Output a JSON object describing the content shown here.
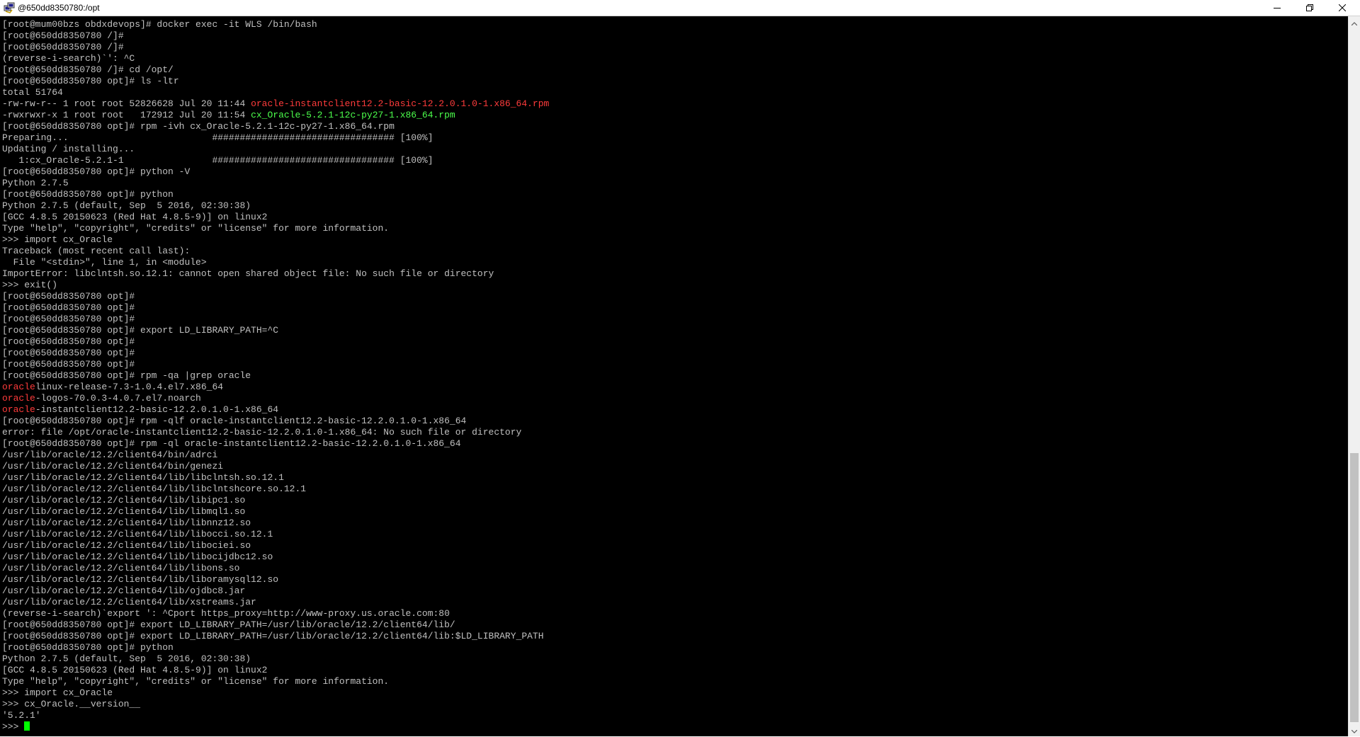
{
  "window": {
    "title": "@650dd8350780:/opt",
    "icon": "putty-icon",
    "controls": [
      "minimize-icon",
      "maximize-icon",
      "close-icon"
    ]
  },
  "colors": {
    "background": "#000000",
    "text": "#c0c0c0",
    "highlight_red": "#ff3b3b",
    "highlight_green": "#4cff4c",
    "cursor": "#00ff00"
  },
  "terminal": {
    "lines": [
      [
        {
          "t": "[root@mum00bzs obdxdevops]# docker exec -it WLS /bin/bash"
        }
      ],
      [
        {
          "t": "[root@650dd8350780 /]#"
        }
      ],
      [
        {
          "t": "[root@650dd8350780 /]#"
        }
      ],
      [
        {
          "t": "(reverse-i-search)`': ^C"
        }
      ],
      [
        {
          "t": "[root@650dd8350780 /]# cd /opt/"
        }
      ],
      [
        {
          "t": "[root@650dd8350780 opt]# ls -ltr"
        }
      ],
      [
        {
          "t": "total 51764"
        }
      ],
      [
        {
          "t": "-rw-rw-r-- 1 root root 52826628 Jul 20 11:44 "
        },
        {
          "t": "oracle-instantclient12.2-basic-12.2.0.1.0-1.x86_64.rpm",
          "c": "red"
        }
      ],
      [
        {
          "t": "-rwxrwxr-x 1 root root   172912 Jul 20 11:54 "
        },
        {
          "t": "cx_Oracle-5.2.1-12c-py27-1.x86_64.rpm",
          "c": "green"
        }
      ],
      [
        {
          "t": "[root@650dd8350780 opt]# rpm -ivh cx_Oracle-5.2.1-12c-py27-1.x86_64.rpm"
        }
      ],
      [
        {
          "t": "Preparing...                          ################################# [100%]"
        }
      ],
      [
        {
          "t": "Updating / installing..."
        }
      ],
      [
        {
          "t": "   1:cx_Oracle-5.2.1-1                ################################# [100%]"
        }
      ],
      [
        {
          "t": "[root@650dd8350780 opt]# python -V"
        }
      ],
      [
        {
          "t": "Python 2.7.5"
        }
      ],
      [
        {
          "t": "[root@650dd8350780 opt]# python"
        }
      ],
      [
        {
          "t": "Python 2.7.5 (default, Sep  5 2016, 02:30:38)"
        }
      ],
      [
        {
          "t": "[GCC 4.8.5 20150623 (Red Hat 4.8.5-9)] on linux2"
        }
      ],
      [
        {
          "t": "Type \"help\", \"copyright\", \"credits\" or \"license\" for more information."
        }
      ],
      [
        {
          "t": ">>> import cx_Oracle"
        }
      ],
      [
        {
          "t": "Traceback (most recent call last):"
        }
      ],
      [
        {
          "t": "  File \"<stdin>\", line 1, in <module>"
        }
      ],
      [
        {
          "t": "ImportError: libclntsh.so.12.1: cannot open shared object file: No such file or directory"
        }
      ],
      [
        {
          "t": ">>> exit()"
        }
      ],
      [
        {
          "t": "[root@650dd8350780 opt]#"
        }
      ],
      [
        {
          "t": "[root@650dd8350780 opt]#"
        }
      ],
      [
        {
          "t": "[root@650dd8350780 opt]#"
        }
      ],
      [
        {
          "t": "[root@650dd8350780 opt]# export LD_LIBRARY_PATH=^C"
        }
      ],
      [
        {
          "t": "[root@650dd8350780 opt]#"
        }
      ],
      [
        {
          "t": "[root@650dd8350780 opt]#"
        }
      ],
      [
        {
          "t": "[root@650dd8350780 opt]#"
        }
      ],
      [
        {
          "t": "[root@650dd8350780 opt]# rpm -qa |grep oracle"
        }
      ],
      [
        {
          "t": "oracle",
          "c": "red"
        },
        {
          "t": "linux-release-7.3-1.0.4.el7.x86_64"
        }
      ],
      [
        {
          "t": "oracle",
          "c": "red"
        },
        {
          "t": "-logos-70.0.3-4.0.7.el7.noarch"
        }
      ],
      [
        {
          "t": "oracle",
          "c": "red"
        },
        {
          "t": "-instantclient12.2-basic-12.2.0.1.0-1.x86_64"
        }
      ],
      [
        {
          "t": "[root@650dd8350780 opt]# rpm -qlf oracle-instantclient12.2-basic-12.2.0.1.0-1.x86_64"
        }
      ],
      [
        {
          "t": "error: file /opt/oracle-instantclient12.2-basic-12.2.0.1.0-1.x86_64: No such file or directory"
        }
      ],
      [
        {
          "t": "[root@650dd8350780 opt]# rpm -ql oracle-instantclient12.2-basic-12.2.0.1.0-1.x86_64"
        }
      ],
      [
        {
          "t": "/usr/lib/oracle/12.2/client64/bin/adrci"
        }
      ],
      [
        {
          "t": "/usr/lib/oracle/12.2/client64/bin/genezi"
        }
      ],
      [
        {
          "t": "/usr/lib/oracle/12.2/client64/lib/libclntsh.so.12.1"
        }
      ],
      [
        {
          "t": "/usr/lib/oracle/12.2/client64/lib/libclntshcore.so.12.1"
        }
      ],
      [
        {
          "t": "/usr/lib/oracle/12.2/client64/lib/libipc1.so"
        }
      ],
      [
        {
          "t": "/usr/lib/oracle/12.2/client64/lib/libmql1.so"
        }
      ],
      [
        {
          "t": "/usr/lib/oracle/12.2/client64/lib/libnnz12.so"
        }
      ],
      [
        {
          "t": "/usr/lib/oracle/12.2/client64/lib/libocci.so.12.1"
        }
      ],
      [
        {
          "t": "/usr/lib/oracle/12.2/client64/lib/libociei.so"
        }
      ],
      [
        {
          "t": "/usr/lib/oracle/12.2/client64/lib/libocijdbc12.so"
        }
      ],
      [
        {
          "t": "/usr/lib/oracle/12.2/client64/lib/libons.so"
        }
      ],
      [
        {
          "t": "/usr/lib/oracle/12.2/client64/lib/liboramysql12.so"
        }
      ],
      [
        {
          "t": "/usr/lib/oracle/12.2/client64/lib/ojdbc8.jar"
        }
      ],
      [
        {
          "t": "/usr/lib/oracle/12.2/client64/lib/xstreams.jar"
        }
      ],
      [
        {
          "t": "(reverse-i-search)`export ': ^Cport https_proxy=http://www-proxy.us.oracle.com:80"
        }
      ],
      [
        {
          "t": "[root@650dd8350780 opt]# export LD_LIBRARY_PATH=/usr/lib/oracle/12.2/client64/lib/"
        }
      ],
      [
        {
          "t": "[root@650dd8350780 opt]# export LD_LIBRARY_PATH=/usr/lib/oracle/12.2/client64/lib:$LD_LIBRARY_PATH"
        }
      ],
      [
        {
          "t": "[root@650dd8350780 opt]# python"
        }
      ],
      [
        {
          "t": "Python 2.7.5 (default, Sep  5 2016, 02:30:38)"
        }
      ],
      [
        {
          "t": "[GCC 4.8.5 20150623 (Red Hat 4.8.5-9)] on linux2"
        }
      ],
      [
        {
          "t": "Type \"help\", \"copyright\", \"credits\" or \"license\" for more information."
        }
      ],
      [
        {
          "t": ">>> import cx_Oracle"
        }
      ],
      [
        {
          "t": ">>> cx_Oracle.__version__"
        }
      ],
      [
        {
          "t": "'5.2.1'"
        }
      ],
      [
        {
          "t": ">>> "
        },
        {
          "cursor": true
        }
      ]
    ]
  }
}
